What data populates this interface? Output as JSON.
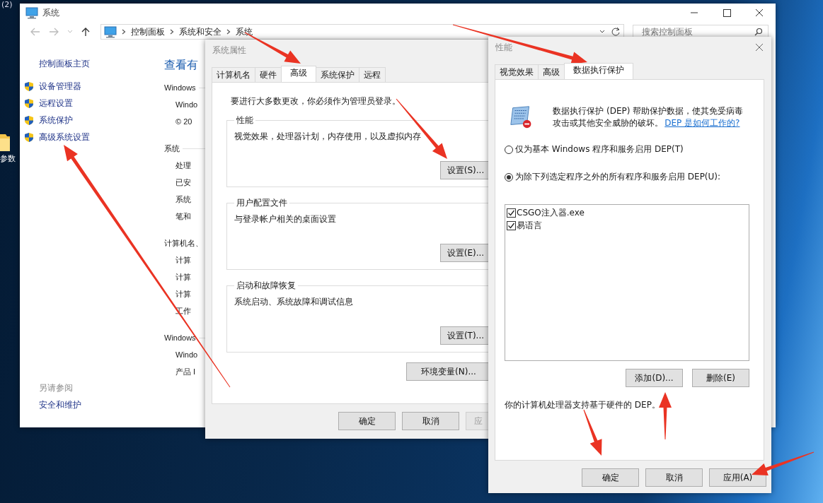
{
  "desktop": {
    "badge": "(2)",
    "icons": [
      {
        "label": "参数"
      }
    ]
  },
  "system_window": {
    "title": "系统",
    "breadcrumb": [
      "控制面板",
      "系统和安全",
      "系统"
    ],
    "search": {
      "placeholder": "搜索控制面板"
    },
    "sidebar": {
      "home": "控制面板主页",
      "items": [
        "设备管理器",
        "远程设置",
        "系统保护",
        "高级系统设置"
      ],
      "see_also_heading": "另请参阅",
      "see_also_items": [
        "安全和维护"
      ]
    },
    "content": [
      {
        "kind": "heading",
        "text": "查看有"
      },
      {
        "kind": "section",
        "text": "Windows"
      },
      {
        "kind": "row",
        "text": "Windo"
      },
      {
        "kind": "row",
        "text": "© 20"
      },
      {
        "kind": "section",
        "text": "系统"
      },
      {
        "kind": "row",
        "text": "处理"
      },
      {
        "kind": "row",
        "text": "已安"
      },
      {
        "kind": "row",
        "text": "系统"
      },
      {
        "kind": "row",
        "text": "笔和"
      },
      {
        "kind": "section",
        "text": "计算机名、"
      },
      {
        "kind": "row",
        "text": "计算"
      },
      {
        "kind": "row",
        "text": "计算"
      },
      {
        "kind": "row",
        "text": "计算"
      },
      {
        "kind": "row",
        "text": "工作"
      },
      {
        "kind": "section",
        "text": "Windows"
      },
      {
        "kind": "row",
        "text": "Windo"
      },
      {
        "kind": "row",
        "text": "产品 I"
      }
    ]
  },
  "system_properties": {
    "title": "系统属性",
    "tabs": [
      {
        "label": "计算机名",
        "selected": false
      },
      {
        "label": "硬件",
        "selected": false
      },
      {
        "label": "高级",
        "selected": true
      },
      {
        "label": "系统保护",
        "selected": false
      },
      {
        "label": "远程",
        "selected": false
      }
    ],
    "notice": "要进行大多数更改，你必须作为管理员登录。",
    "groups": [
      {
        "title": "性能",
        "description": "视觉效果，处理器计划，内存使用，以及虚拟内存",
        "button": "设置(S)..."
      },
      {
        "title": "用户配置文件",
        "description": "与登录帐户相关的桌面设置",
        "button": "设置(E)..."
      },
      {
        "title": "启动和故障恢复",
        "description": "系统启动、系统故障和调试信息",
        "button": "设置(T)..."
      }
    ],
    "env_button": "环境变量(N)...",
    "buttons": [
      {
        "label": "确定",
        "disabled": false
      },
      {
        "label": "取消",
        "disabled": false
      },
      {
        "label": "应",
        "disabled": true
      }
    ]
  },
  "performance_options": {
    "title": "性能",
    "tabs": [
      {
        "label": "视觉效果",
        "selected": false
      },
      {
        "label": "高级",
        "selected": false
      },
      {
        "label": "数据执行保护",
        "selected": true
      }
    ],
    "description": "数据执行保护 (DEP) 帮助保护数据，使其免受病毒攻击或其他安全威胁的破坏。",
    "link": "DEP 是如何工作的?",
    "radios": [
      {
        "label": "仅为基本 Windows 程序和服务启用 DEP(T)",
        "selected": false
      },
      {
        "label": "为除下列选定程序之外的所有程序和服务启用 DEP(U):",
        "selected": true
      }
    ],
    "exceptions": [
      {
        "label": "CSGO注入器.exe",
        "checked": true
      },
      {
        "label": "易语言",
        "checked": true
      }
    ],
    "list_buttons": [
      "添加(D)...",
      "删除(E)"
    ],
    "hardware_note": "你的计算机处理器支持基于硬件的 DEP。",
    "buttons": [
      {
        "label": "确定",
        "disabled": false
      },
      {
        "label": "取消",
        "disabled": false
      },
      {
        "label": "应用(A)",
        "disabled": false
      }
    ]
  }
}
